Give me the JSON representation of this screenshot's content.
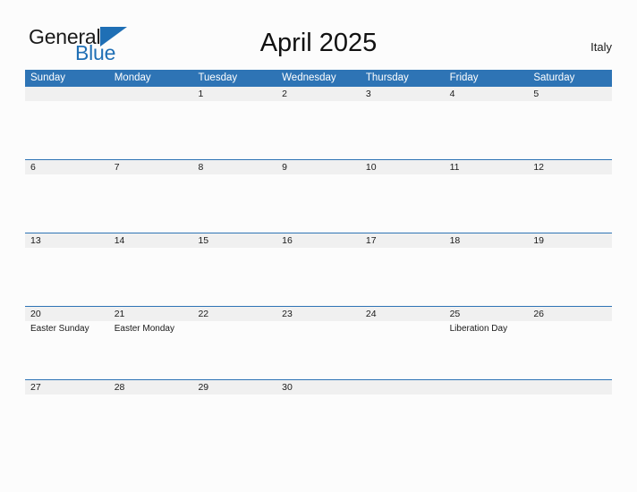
{
  "logo": {
    "word_one": "General",
    "word_two": "Blue",
    "triangle_icon": "blue-triangle-icon",
    "brand_color": "#1f6fb5"
  },
  "header": {
    "title": "April 2025",
    "region": "Italy"
  },
  "colors": {
    "header_blue": "#2e74b5",
    "number_band_gray": "#f0f0f0",
    "page_background": "#fcfcfc",
    "text": "#1a1a1a"
  },
  "calendar": {
    "month": "April",
    "year": "2025",
    "weekday_headers": [
      "Sunday",
      "Monday",
      "Tuesday",
      "Wednesday",
      "Thursday",
      "Friday",
      "Saturday"
    ],
    "weeks": [
      {
        "days": [
          {
            "number": "",
            "event": ""
          },
          {
            "number": "",
            "event": ""
          },
          {
            "number": "1",
            "event": ""
          },
          {
            "number": "2",
            "event": ""
          },
          {
            "number": "3",
            "event": ""
          },
          {
            "number": "4",
            "event": ""
          },
          {
            "number": "5",
            "event": ""
          }
        ]
      },
      {
        "days": [
          {
            "number": "6",
            "event": ""
          },
          {
            "number": "7",
            "event": ""
          },
          {
            "number": "8",
            "event": ""
          },
          {
            "number": "9",
            "event": ""
          },
          {
            "number": "10",
            "event": ""
          },
          {
            "number": "11",
            "event": ""
          },
          {
            "number": "12",
            "event": ""
          }
        ]
      },
      {
        "days": [
          {
            "number": "13",
            "event": ""
          },
          {
            "number": "14",
            "event": ""
          },
          {
            "number": "15",
            "event": ""
          },
          {
            "number": "16",
            "event": ""
          },
          {
            "number": "17",
            "event": ""
          },
          {
            "number": "18",
            "event": ""
          },
          {
            "number": "19",
            "event": ""
          }
        ]
      },
      {
        "days": [
          {
            "number": "20",
            "event": "Easter Sunday"
          },
          {
            "number": "21",
            "event": "Easter Monday"
          },
          {
            "number": "22",
            "event": ""
          },
          {
            "number": "23",
            "event": ""
          },
          {
            "number": "24",
            "event": ""
          },
          {
            "number": "25",
            "event": "Liberation Day"
          },
          {
            "number": "26",
            "event": ""
          }
        ]
      },
      {
        "days": [
          {
            "number": "27",
            "event": ""
          },
          {
            "number": "28",
            "event": ""
          },
          {
            "number": "29",
            "event": ""
          },
          {
            "number": "30",
            "event": ""
          },
          {
            "number": "",
            "event": ""
          },
          {
            "number": "",
            "event": ""
          },
          {
            "number": "",
            "event": ""
          }
        ]
      }
    ]
  }
}
